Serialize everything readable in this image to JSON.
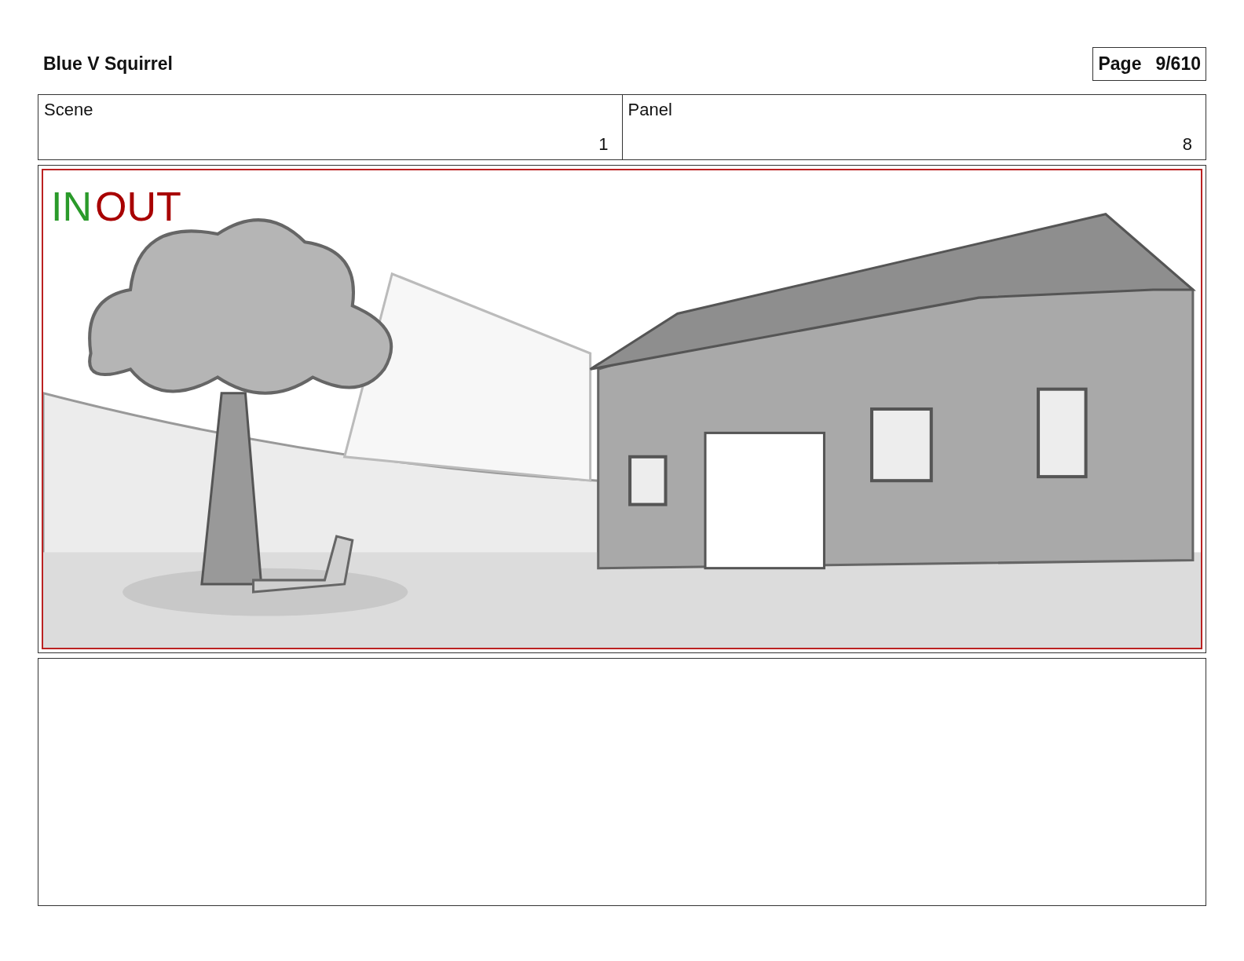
{
  "header": {
    "title": "Blue V Squirrel",
    "page_label": "Page",
    "page_number": "9/610"
  },
  "fields": [
    {
      "label": "Scene",
      "value": "1"
    },
    {
      "label": "Panel",
      "value": "8"
    }
  ],
  "panel": {
    "markers": [
      {
        "text": "IN",
        "color": "#2a9a2a"
      },
      {
        "text": "OUT",
        "color": "#a80000"
      }
    ]
  }
}
